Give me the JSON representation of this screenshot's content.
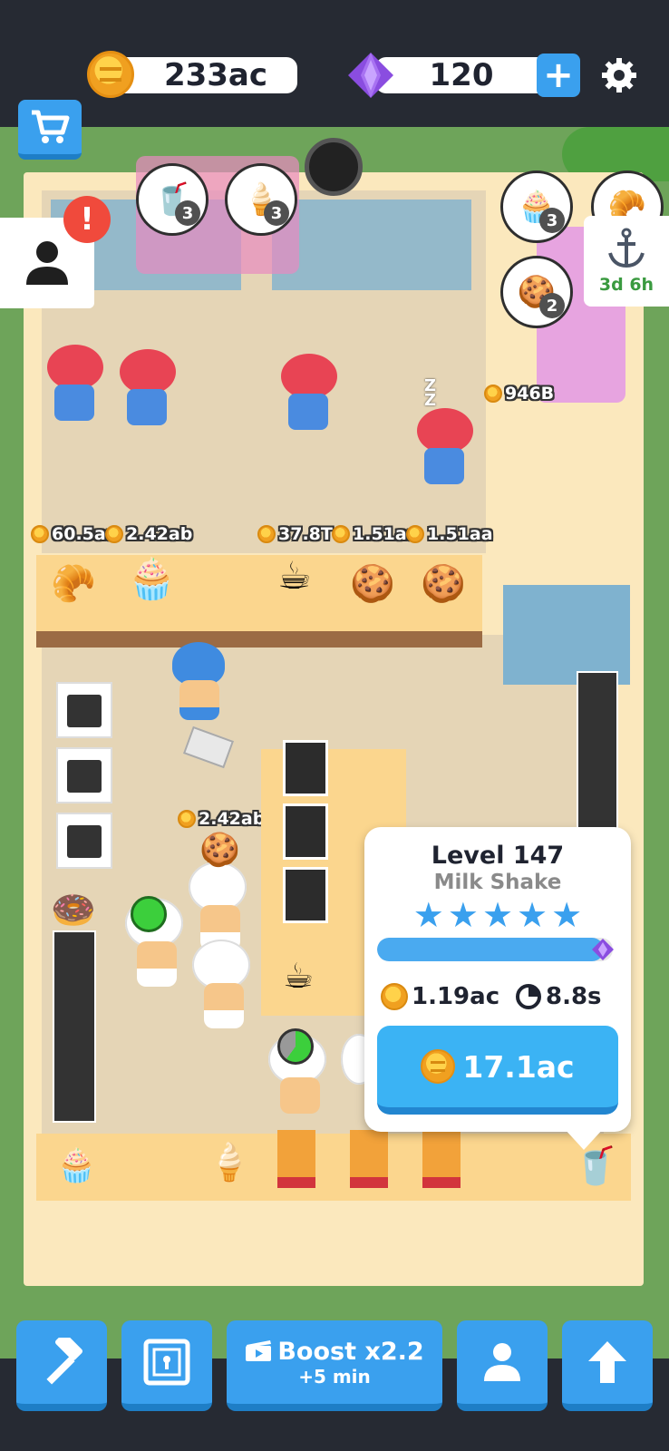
{
  "top_bar": {
    "coins": "233ac",
    "gems": "120",
    "gems_add": "+"
  },
  "side_panel": {
    "alert": "!",
    "event_timer": "3d 6h"
  },
  "orders": [
    {
      "item": "milkshake",
      "count": "3"
    },
    {
      "item": "ice-cream",
      "count": "3"
    },
    {
      "item": "muffin",
      "count": "3"
    },
    {
      "item": "cookie",
      "count": "2"
    }
  ],
  "sleep_indicator": "Z\nZ",
  "customer_tip": "946B",
  "station_prices": [
    "60.5aa",
    "2.42ab",
    "37.8T",
    "1.51aa",
    "1.51aa"
  ],
  "worker_price": "2.42ab",
  "upgrade_popup": {
    "level": "Level 147",
    "item_name": "Milk Shake",
    "stars": 5,
    "progress": 0.96,
    "income": "1.19ac",
    "time": "8.8s",
    "upgrade_cost": "17.1ac"
  },
  "bottom_bar": {
    "boost_label": "Boost x2.2",
    "boost_sub": "+5 min"
  },
  "colors": {
    "accent_blue": "#3aa0ee",
    "coin_gold": "#f0a020",
    "gem_purple": "#8a4de0",
    "dark_bar": "#262a33"
  }
}
